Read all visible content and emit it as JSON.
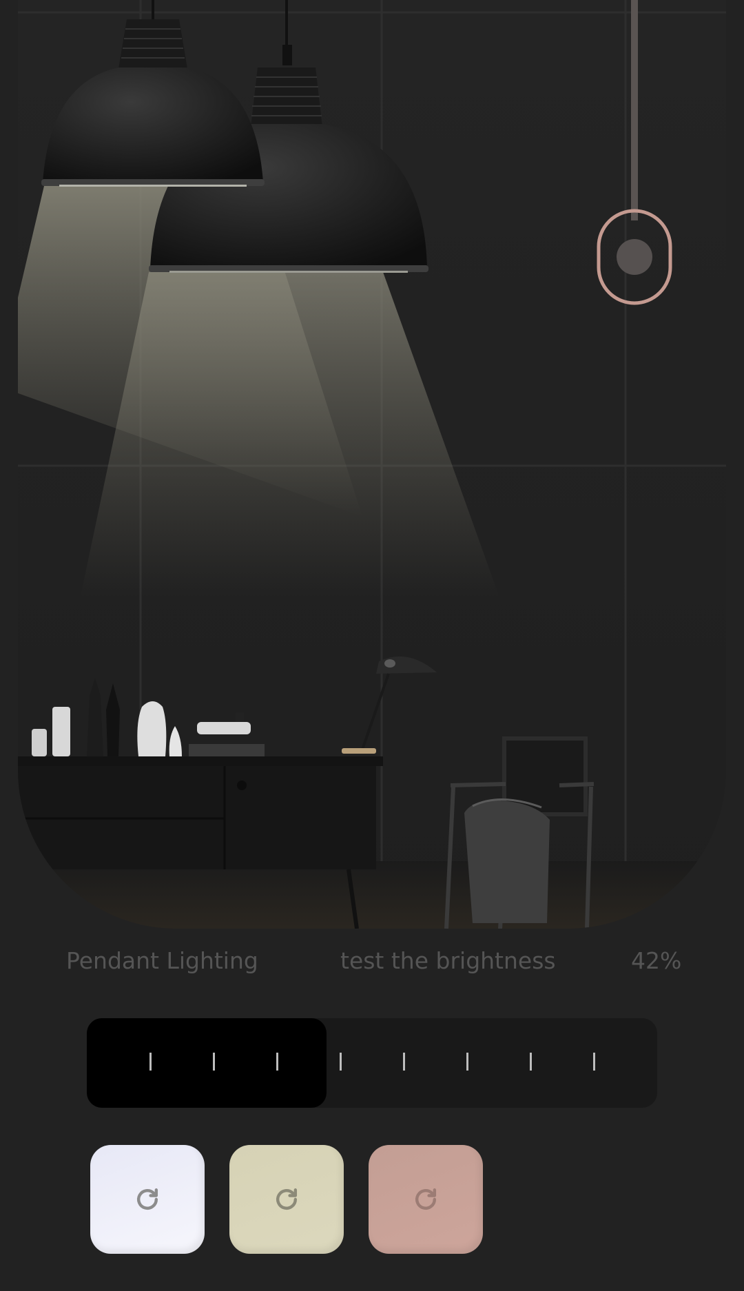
{
  "app": {
    "title": "Pendant Lighting",
    "subtitle": "test the brightness",
    "brightness_label": "42%"
  },
  "brightness": {
    "value_fraction": 0.42,
    "tick_count": 8
  },
  "colors": {
    "background": "#222222",
    "scene_fill": "#242424",
    "slider_track": "#191919",
    "slider_fill": "#000000",
    "pull_switch_ring": "#c49a90",
    "text_muted": "#555555"
  },
  "swatches": [
    {
      "name": "cool-white",
      "color": "#eef0fb",
      "icon": "refresh-icon"
    },
    {
      "name": "warm-ivory",
      "color": "#d8d4b8",
      "icon": "refresh-icon"
    },
    {
      "name": "rose",
      "color": "#c9a298",
      "icon": "refresh-icon"
    }
  ]
}
